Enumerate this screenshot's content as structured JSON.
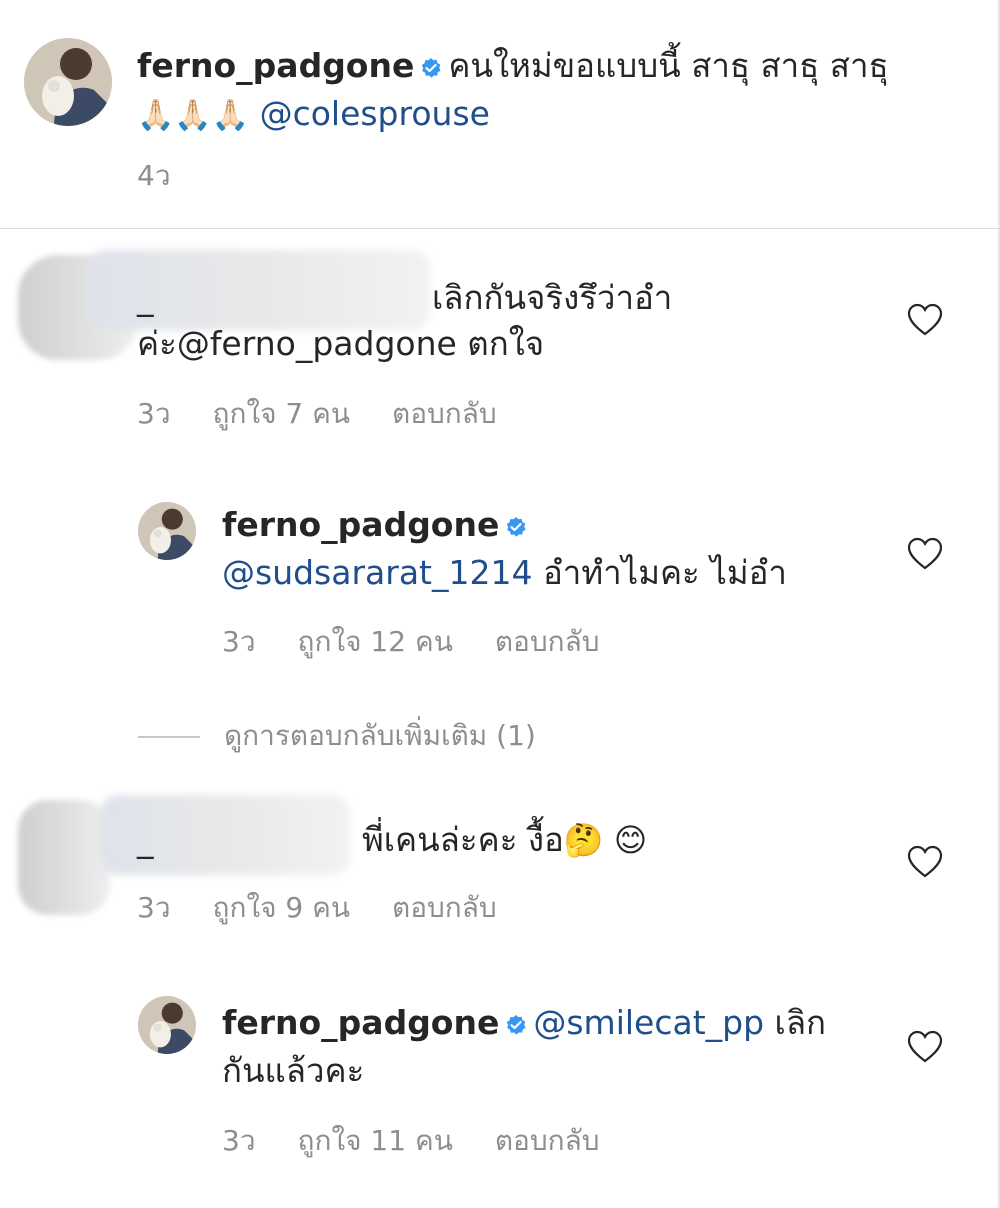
{
  "caption": {
    "username": "ferno_padgone",
    "text": "คนใหม่ขอแบบนี้ สาธุ สาธุ สาธุ",
    "emoji": "🙏🏻🙏🏻🙏🏻",
    "mention": "@colesprouse",
    "time": "4ว"
  },
  "comments": [
    {
      "username_partial": "_",
      "text_line1": "เลิกกันจริงรึว่าอำ",
      "text_line2_prefix": "ค่ะ",
      "mention": "@ferno_padgone",
      "text_line2_suffix": " ตกใจ",
      "time": "3ว",
      "likes": "ถูกใจ 7 คน",
      "reply": "ตอบกลับ",
      "replies": [
        {
          "username": "ferno_padgone",
          "mention": "@sudsararat_1214",
          "text": " อำทำไมคะ ไม่อำ",
          "time": "3ว",
          "likes": "ถูกใจ 12 คน",
          "reply": "ตอบกลับ"
        }
      ],
      "view_more": "ดูการตอบกลับเพิ่มเติม (1)"
    },
    {
      "username_partial": "_",
      "text": "พี่เคนล่ะคะ งื้อ",
      "emoji": "🤔 😊",
      "time": "3ว",
      "likes": "ถูกใจ 9 คน",
      "reply": "ตอบกลับ",
      "replies": [
        {
          "username": "ferno_padgone",
          "mention": "@smilecat_pp",
          "text_line1": " เลิก",
          "text_line2": "กันแล้วคะ",
          "time": "3ว",
          "likes": "ถูกใจ 11 คน",
          "reply": "ตอบกลับ"
        }
      ]
    }
  ],
  "icons": {
    "verified": "verified-badge-icon",
    "heart": "heart-outline-icon"
  },
  "colors": {
    "text": "#262626",
    "secondary": "#8e8e8e",
    "mention": "#1f4e8c",
    "verified": "#3897f0"
  }
}
